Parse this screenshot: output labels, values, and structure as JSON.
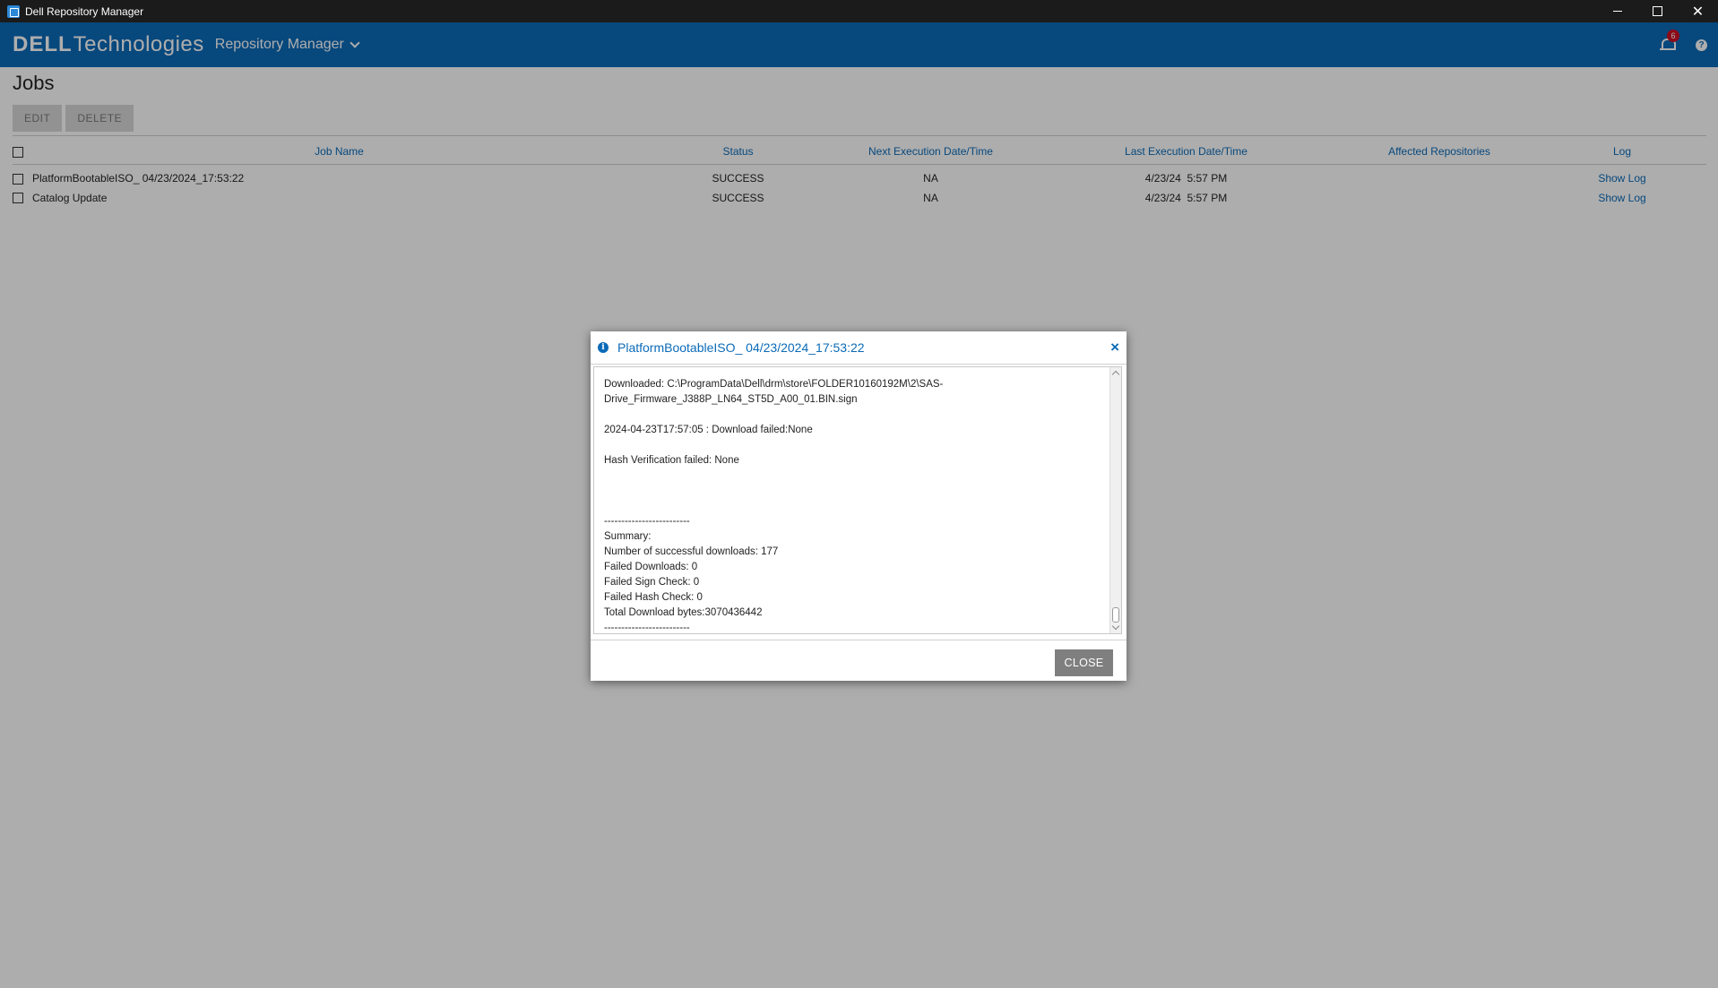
{
  "window": {
    "title": "Dell Repository Manager",
    "controls": {
      "minimize": "minimize-icon",
      "maximize": "maximize-icon",
      "close": "✕"
    }
  },
  "header": {
    "brand_dell": "DELL",
    "brand_tech": "Technologies",
    "app_name": "Repository Manager",
    "notification_count": "6",
    "help_label": "?"
  },
  "page": {
    "title": "Jobs",
    "toolbar": {
      "edit_label": "EDIT",
      "delete_label": "DELETE"
    }
  },
  "table": {
    "columns": [
      "Job Name",
      "Status",
      "Next Execution Date/Time",
      "Last Execution Date/Time",
      "Affected Repositories",
      "Log"
    ],
    "rows": [
      {
        "name": "PlatformBootableISO_ 04/23/2024_17:53:22",
        "status": "SUCCESS",
        "next": "NA",
        "last_date": "4/23/24",
        "last_time": "5:57 PM",
        "repos": "",
        "log": "Show Log"
      },
      {
        "name": "Catalog Update",
        "status": "SUCCESS",
        "next": "NA",
        "last_date": "4/23/24",
        "last_time": "5:57 PM",
        "repos": "",
        "log": "Show Log"
      }
    ]
  },
  "dialog": {
    "title": "PlatformBootableISO_ 04/23/2024_17:53:22",
    "close_x": "×",
    "log_text": "Downloaded: C:\\ProgramData\\Dell\\drm\\store\\FOLDER10160192M\\2\\SAS-\nDrive_Firmware_J388P_LN64_ST5D_A00_01.BIN.sign\n\n2024-04-23T17:57:05 : Download failed:None\n\nHash Verification failed: None\n\n\n\n-------------------------\nSummary:\nNumber of successful downloads: 177\nFailed Downloads: 0\nFailed Sign Check: 0\nFailed Hash Check: 0\nTotal Download bytes:3070436442\n-------------------------",
    "close_button": "CLOSE"
  }
}
